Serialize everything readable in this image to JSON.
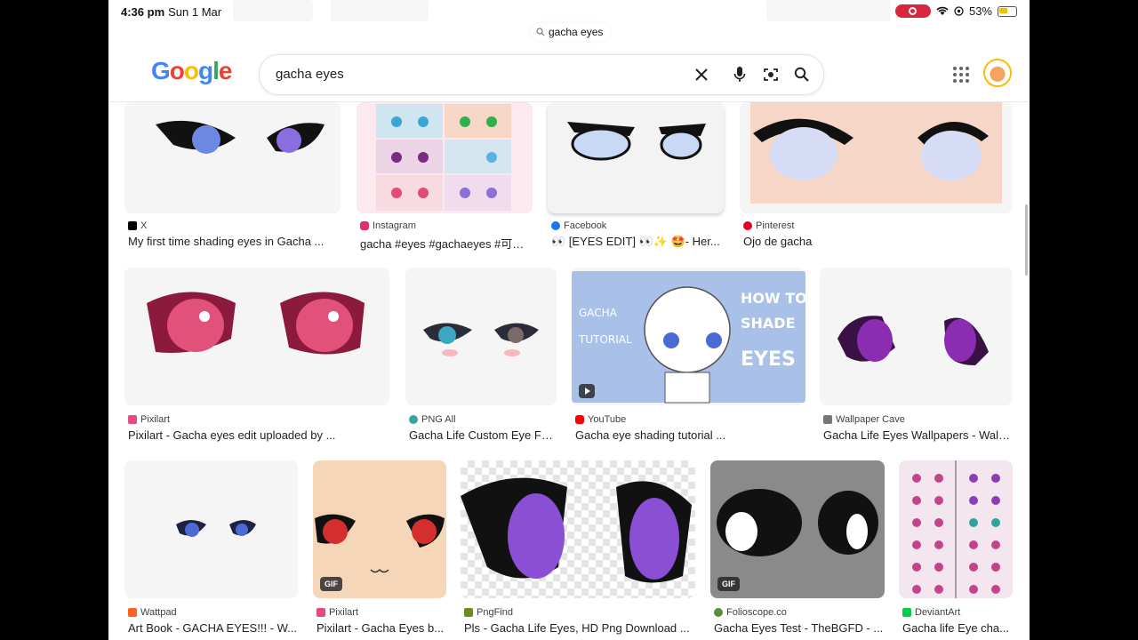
{
  "status": {
    "time": "4:36 pm",
    "date": "Sun 1 Mar",
    "battery": "53%"
  },
  "tab_pill": "gacha eyes",
  "logo": {
    "G": "G",
    "o1": "o",
    "o2": "o",
    "g": "g",
    "l": "l",
    "e": "e"
  },
  "search": {
    "query": "gacha eyes"
  },
  "results": [
    {
      "source": "X",
      "title": "My first time shading eyes in Gacha ...",
      "color": "#000000",
      "thumb": "white-dark-eyes"
    },
    {
      "source": "Instagram",
      "title": "gacha #eyes #gachaeyes #可愛...",
      "color": "#e1306c",
      "thumb": "grid"
    },
    {
      "source": "Facebook",
      "title": "👀 [EYES EDIT] 👀✨ 🤩- Her...",
      "color": "#1877f2",
      "thumb": "white-blue-eyes"
    },
    {
      "source": "Pinterest",
      "title": "Ojo de gacha",
      "color": "#e60023",
      "thumb": "peach-eyes"
    },
    {
      "source": "Pixilart",
      "title": "Pixilart - Gacha eyes edit uploaded by ...",
      "color": "#e84a7f",
      "thumb": "pink-eyes"
    },
    {
      "source": "PNG All",
      "title": "Gacha Life Custom Eye Fe...",
      "color": "#3aa39a",
      "thumb": "teal-eyes"
    },
    {
      "source": "YouTube",
      "title": "Gacha eye shading tutorial ...",
      "color": "#ff0000",
      "thumb": "tutorial",
      "thumb_text": [
        "GACHA",
        "TUTORIAL",
        "HOW TO",
        "SHADE",
        "EYES"
      ]
    },
    {
      "source": "Wallpaper Cave",
      "title": "Gacha Life Eyes Wallpapers - Wall...",
      "color": "#777777",
      "thumb": "purple-eyes"
    },
    {
      "source": "Wattpad",
      "title": "Art Book - GACHA EYES!!! - W...",
      "color": "#ff6122",
      "thumb": "small-blue-eyes"
    },
    {
      "source": "Pixilart",
      "title": "Pixilart - Gacha Eyes b...",
      "color": "#e84a7f",
      "thumb": "red-eyes",
      "badge": "GIF"
    },
    {
      "source": "PngFind",
      "title": "Pls - Gacha Life Eyes, HD Png Download ...",
      "color": "#6b8e23",
      "thumb": "violet-eyes"
    },
    {
      "source": "Folioscope.co",
      "title": "Gacha Eyes Test - TheBGFD - ...",
      "color": "#5a8f3a",
      "thumb": "black-eyes",
      "badge": "GIF"
    },
    {
      "source": "DeviantArt",
      "title": "Gacha life Eye cha...",
      "color": "#05cc47",
      "thumb": "chart"
    }
  ]
}
